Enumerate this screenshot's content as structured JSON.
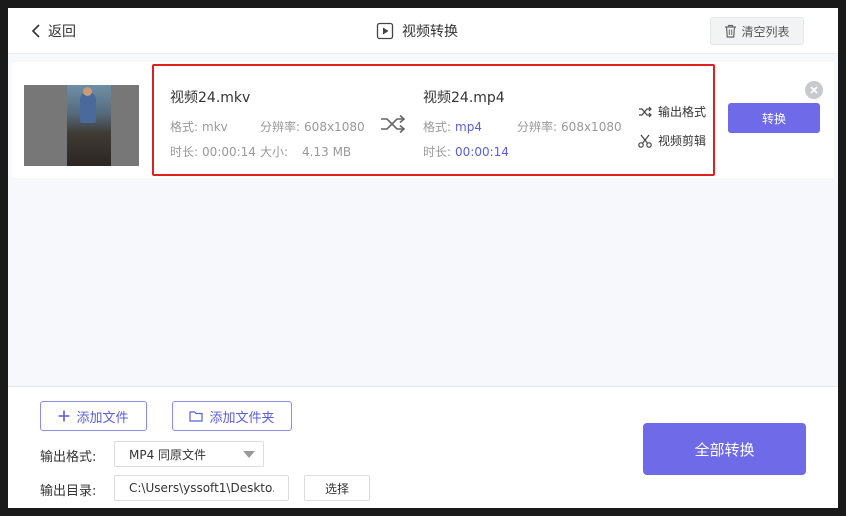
{
  "header": {
    "back_label": "返回",
    "title": "视频转换",
    "clear_label": "清空列表"
  },
  "file": {
    "source": {
      "name": "视频24.mkv",
      "format_label": "格式:",
      "format": "mkv",
      "resolution_label": "分辨率:",
      "resolution": "608x1080",
      "duration_label": "时长:",
      "duration": "00:00:14",
      "size_label": "大小:",
      "size": "4.13 MB"
    },
    "output": {
      "name": "视频24.mp4",
      "format_label": "格式:",
      "format": "mp4",
      "resolution_label": "分辨率:",
      "resolution": "608x1080",
      "duration_label": "时长:",
      "duration": "00:00:14"
    },
    "actions": {
      "output_format": "输出格式",
      "video_edit": "视频剪辑"
    },
    "convert_label": "转换"
  },
  "bottom": {
    "add_file": "添加文件",
    "add_folder": "添加文件夹",
    "output_format_label": "输出格式:",
    "output_format_value": "MP4 同原文件",
    "output_dir_label": "输出目录:",
    "output_dir_value": "C:\\Users\\yssoft1\\Deskto...",
    "choose_label": "选择",
    "convert_all": "全部转换"
  },
  "colors": {
    "accent": "#6e6ae8",
    "highlight_border": "#e02020"
  }
}
